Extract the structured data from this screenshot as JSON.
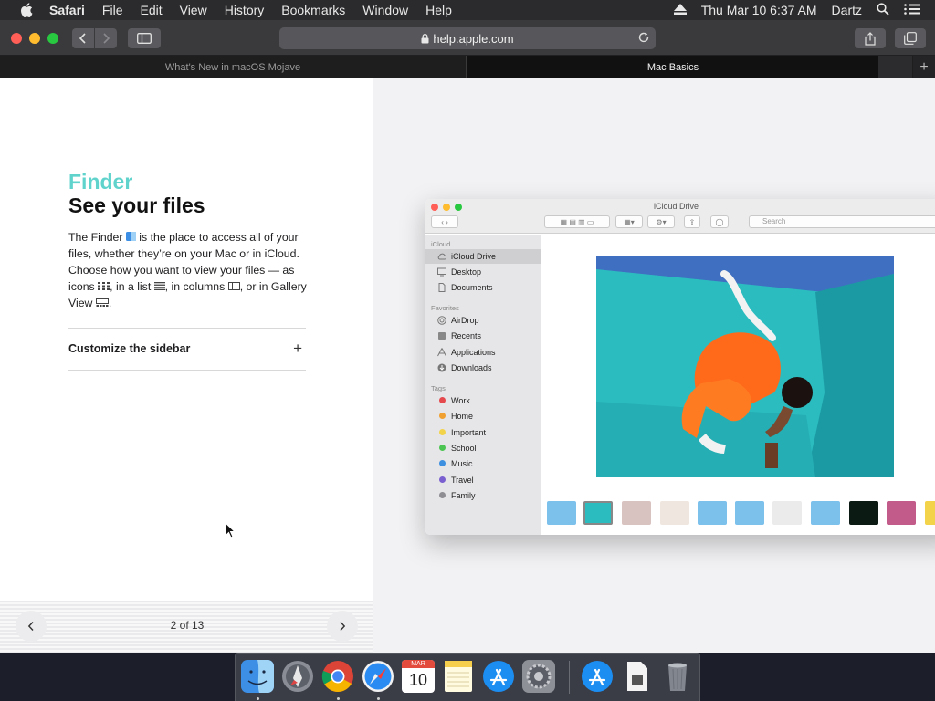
{
  "menubar": {
    "app_name": "Safari",
    "items": [
      "File",
      "Edit",
      "View",
      "History",
      "Bookmarks",
      "Window",
      "Help"
    ],
    "datetime": "Thu Mar 10  6:37 AM",
    "user": "Dartz"
  },
  "toolbar": {
    "url": "help.apple.com"
  },
  "tabs": [
    {
      "label": "What's New in macOS Mojave",
      "active": false
    },
    {
      "label": "Mac Basics",
      "active": true
    }
  ],
  "article": {
    "eyebrow": "Finder",
    "headline": "See your files",
    "body_parts": [
      "The Finder ",
      " is the place to access all of your files, whether they’re on your Mac or in iCloud. Choose how you want to view your files — as icons ",
      ", in a list ",
      ", in columns ",
      ", or in Gallery View ",
      "."
    ],
    "accordion_label": "Customize the sidebar",
    "pager": {
      "count": "2 of 13"
    }
  },
  "finder": {
    "title": "iCloud Drive",
    "search_placeholder": "Search",
    "sections": {
      "icloud": "iCloud",
      "favorites": "Favorites",
      "tags": "Tags"
    },
    "icloud_items": [
      "iCloud Drive",
      "Desktop",
      "Documents"
    ],
    "favorite_items": [
      "AirDrop",
      "Recents",
      "Applications",
      "Downloads"
    ],
    "tag_items": [
      {
        "label": "Work",
        "color": "#e5484d"
      },
      {
        "label": "Home",
        "color": "#f0a030"
      },
      {
        "label": "Important",
        "color": "#f2d34a"
      },
      {
        "label": "School",
        "color": "#4cc552"
      },
      {
        "label": "Music",
        "color": "#3d8fe0"
      },
      {
        "label": "Travel",
        "color": "#7a5fd0"
      },
      {
        "label": "Family",
        "color": "#8e8e93"
      }
    ]
  },
  "dock": {
    "apps": [
      "finder",
      "launchpad",
      "chrome",
      "safari",
      "calendar",
      "notes",
      "app-store",
      "system-preferences",
      "downloads-stack",
      "documents-stack",
      "trash"
    ],
    "calendar": {
      "month": "MAR",
      "day": "10"
    }
  },
  "colors": {
    "accent": "#5fd3cc",
    "menubar": "#2b2b2d",
    "toolbar": "#3a3a3c"
  }
}
